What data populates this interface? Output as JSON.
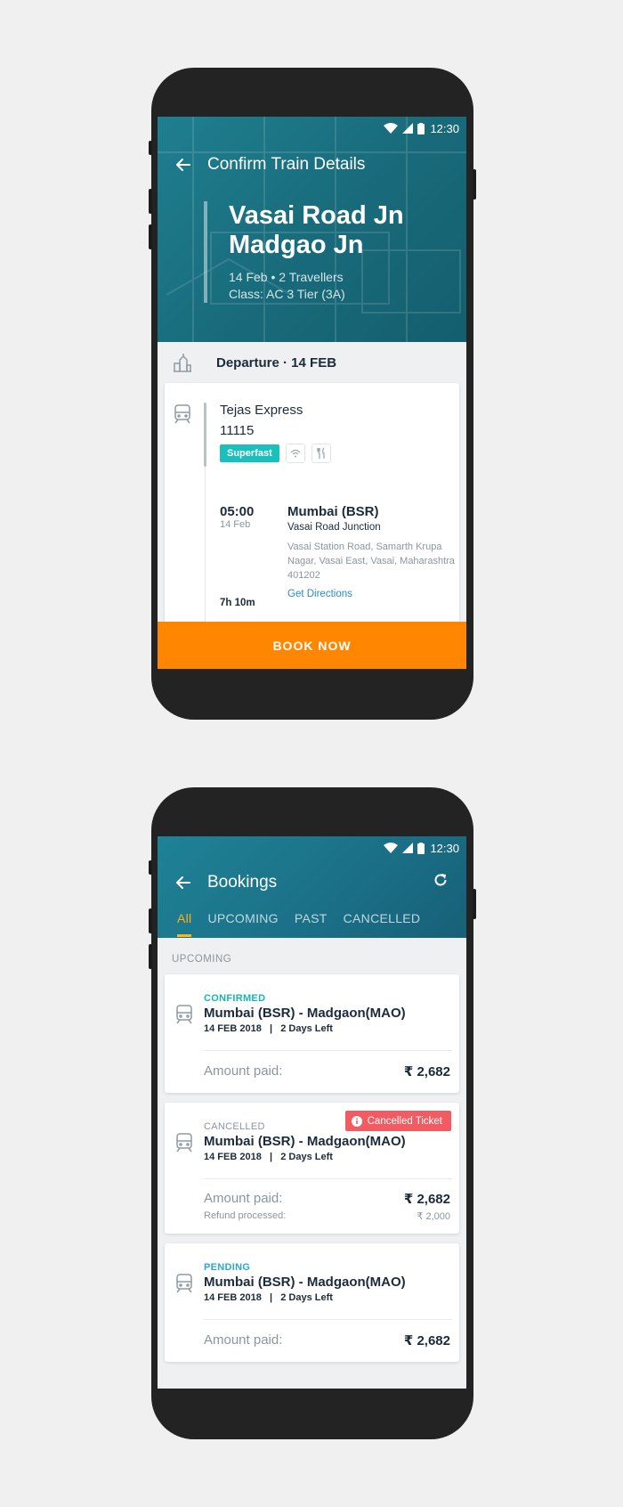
{
  "status_bar": {
    "time": "12:30"
  },
  "confirm_screen": {
    "title": "Confirm Train Details",
    "route_from": "Vasai Road Jn",
    "route_to": "Madgao Jn",
    "trip_info": "14 Feb • 2 Travellers",
    "class_info": "Class: AC 3 Tier (3A)",
    "departure_header": "Departure · 14 FEB",
    "train": {
      "name": "Tejas Express",
      "number": "11115",
      "badge": "Superfast",
      "amenity_icons": [
        "wifi-icon",
        "food-icon"
      ],
      "time": "05:00",
      "date": "14 Feb",
      "station_code": "Mumbai (BSR)",
      "station_name": "Vasai Road Junction",
      "address": "Vasai Station Road, Samarth Krupa Nagar, Vasai East, Vasai, Maharashtra 401202",
      "directions_label": "Get Directions",
      "duration": "7h 10m"
    },
    "book_button": "BOOK NOW"
  },
  "bookings_screen": {
    "title": "Bookings",
    "tabs": [
      "All",
      "UPCOMING",
      "PAST",
      "CANCELLED"
    ],
    "active_tab": "All",
    "section_label": "UPCOMING",
    "bookings": [
      {
        "status": "CONFIRMED",
        "status_color": "#1ab5b0",
        "route": "Mumbai (BSR) - Madgaon(MAO)",
        "date_info": "14 FEB 2018   |   2 Days Left",
        "amount_label": "Amount paid:",
        "amount": "₹ 2,682"
      },
      {
        "status": "CANCELLED",
        "status_color": "#8a969f",
        "badge": "Cancelled Ticket",
        "route": "Mumbai (BSR) - Madgaon(MAO)",
        "date_info": "14 FEB 2018   |   2 Days Left",
        "amount_label": "Amount paid:",
        "amount": "₹ 2,682",
        "refund_label": "Refund processed:",
        "refund_amount": "₹ 2,000"
      },
      {
        "status": "PENDING",
        "status_color": "#2aa7d8",
        "route": "Mumbai (BSR) - Madgaon(MAO)",
        "date_info": "14 FEB 2018   |   2 Days Left",
        "amount_label": "Amount paid:",
        "amount": "₹ 2,682"
      }
    ]
  },
  "colors": {
    "header_teal": "#1a6f86",
    "accent_orange": "#ff8600",
    "tab_active": "#ffb21a",
    "superfast": "#1ac0bb",
    "cancel_badge": "#f25b61"
  }
}
